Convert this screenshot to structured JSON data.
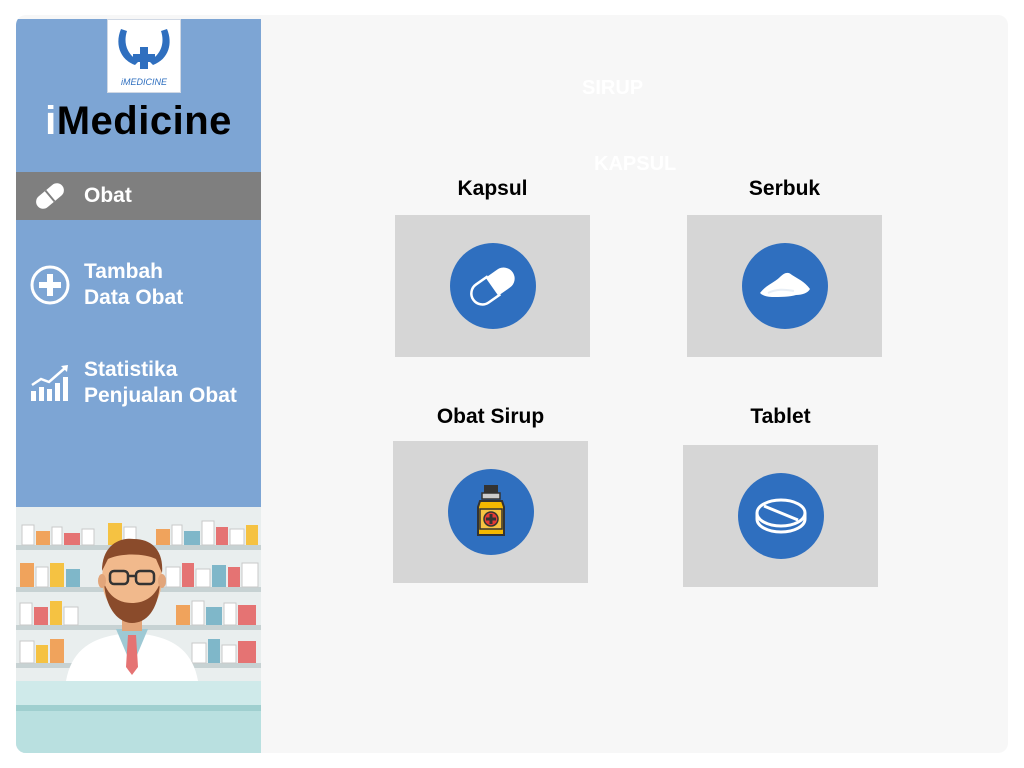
{
  "app": {
    "title_i": "i",
    "title_rest": "Medicine",
    "logo_text": "iMEDICINE"
  },
  "sidebar": {
    "items": [
      {
        "label": "Obat",
        "icon": "pill-icon",
        "active": true
      },
      {
        "label": "Tambah\nData Obat",
        "icon": "plus-circle-icon",
        "active": false
      },
      {
        "label": "Statistika\nPenjualan Obat",
        "icon": "chart-icon",
        "active": false
      }
    ]
  },
  "ghost": {
    "line1": "SIRUP",
    "line2": "KAPSUL"
  },
  "categories": [
    {
      "title": "Kapsul",
      "icon": "capsule-icon"
    },
    {
      "title": "Serbuk",
      "icon": "powder-icon"
    },
    {
      "title": "Obat Sirup",
      "icon": "syrup-bottle-icon"
    },
    {
      "title": "Tablet",
      "icon": "tablet-icon"
    }
  ],
  "colors": {
    "sidebar_bg": "#7da5d4",
    "active_bg": "#7f7f7f",
    "circle_bg": "#2f6fbf",
    "card_bg": "#d6d6d6"
  }
}
